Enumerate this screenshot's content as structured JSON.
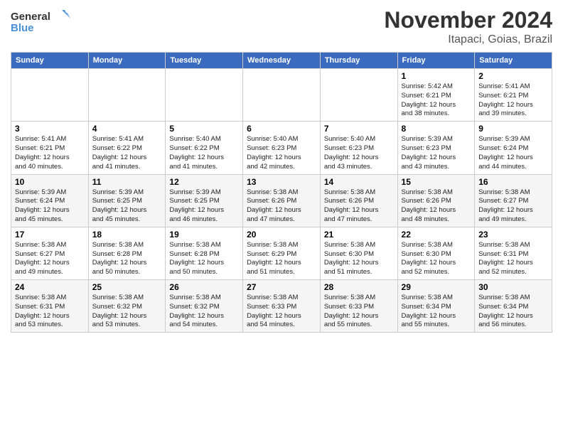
{
  "header": {
    "logo_line1": "General",
    "logo_line2": "Blue",
    "title": "November 2024",
    "subtitle": "Itapaci, Goias, Brazil"
  },
  "days_of_week": [
    "Sunday",
    "Monday",
    "Tuesday",
    "Wednesday",
    "Thursday",
    "Friday",
    "Saturday"
  ],
  "weeks": [
    [
      {
        "num": "",
        "info": ""
      },
      {
        "num": "",
        "info": ""
      },
      {
        "num": "",
        "info": ""
      },
      {
        "num": "",
        "info": ""
      },
      {
        "num": "",
        "info": ""
      },
      {
        "num": "1",
        "info": "Sunrise: 5:42 AM\nSunset: 6:21 PM\nDaylight: 12 hours\nand 38 minutes."
      },
      {
        "num": "2",
        "info": "Sunrise: 5:41 AM\nSunset: 6:21 PM\nDaylight: 12 hours\nand 39 minutes."
      }
    ],
    [
      {
        "num": "3",
        "info": "Sunrise: 5:41 AM\nSunset: 6:21 PM\nDaylight: 12 hours\nand 40 minutes."
      },
      {
        "num": "4",
        "info": "Sunrise: 5:41 AM\nSunset: 6:22 PM\nDaylight: 12 hours\nand 41 minutes."
      },
      {
        "num": "5",
        "info": "Sunrise: 5:40 AM\nSunset: 6:22 PM\nDaylight: 12 hours\nand 41 minutes."
      },
      {
        "num": "6",
        "info": "Sunrise: 5:40 AM\nSunset: 6:23 PM\nDaylight: 12 hours\nand 42 minutes."
      },
      {
        "num": "7",
        "info": "Sunrise: 5:40 AM\nSunset: 6:23 PM\nDaylight: 12 hours\nand 43 minutes."
      },
      {
        "num": "8",
        "info": "Sunrise: 5:39 AM\nSunset: 6:23 PM\nDaylight: 12 hours\nand 43 minutes."
      },
      {
        "num": "9",
        "info": "Sunrise: 5:39 AM\nSunset: 6:24 PM\nDaylight: 12 hours\nand 44 minutes."
      }
    ],
    [
      {
        "num": "10",
        "info": "Sunrise: 5:39 AM\nSunset: 6:24 PM\nDaylight: 12 hours\nand 45 minutes."
      },
      {
        "num": "11",
        "info": "Sunrise: 5:39 AM\nSunset: 6:25 PM\nDaylight: 12 hours\nand 45 minutes."
      },
      {
        "num": "12",
        "info": "Sunrise: 5:39 AM\nSunset: 6:25 PM\nDaylight: 12 hours\nand 46 minutes."
      },
      {
        "num": "13",
        "info": "Sunrise: 5:38 AM\nSunset: 6:26 PM\nDaylight: 12 hours\nand 47 minutes."
      },
      {
        "num": "14",
        "info": "Sunrise: 5:38 AM\nSunset: 6:26 PM\nDaylight: 12 hours\nand 47 minutes."
      },
      {
        "num": "15",
        "info": "Sunrise: 5:38 AM\nSunset: 6:26 PM\nDaylight: 12 hours\nand 48 minutes."
      },
      {
        "num": "16",
        "info": "Sunrise: 5:38 AM\nSunset: 6:27 PM\nDaylight: 12 hours\nand 49 minutes."
      }
    ],
    [
      {
        "num": "17",
        "info": "Sunrise: 5:38 AM\nSunset: 6:27 PM\nDaylight: 12 hours\nand 49 minutes."
      },
      {
        "num": "18",
        "info": "Sunrise: 5:38 AM\nSunset: 6:28 PM\nDaylight: 12 hours\nand 50 minutes."
      },
      {
        "num": "19",
        "info": "Sunrise: 5:38 AM\nSunset: 6:28 PM\nDaylight: 12 hours\nand 50 minutes."
      },
      {
        "num": "20",
        "info": "Sunrise: 5:38 AM\nSunset: 6:29 PM\nDaylight: 12 hours\nand 51 minutes."
      },
      {
        "num": "21",
        "info": "Sunrise: 5:38 AM\nSunset: 6:30 PM\nDaylight: 12 hours\nand 51 minutes."
      },
      {
        "num": "22",
        "info": "Sunrise: 5:38 AM\nSunset: 6:30 PM\nDaylight: 12 hours\nand 52 minutes."
      },
      {
        "num": "23",
        "info": "Sunrise: 5:38 AM\nSunset: 6:31 PM\nDaylight: 12 hours\nand 52 minutes."
      }
    ],
    [
      {
        "num": "24",
        "info": "Sunrise: 5:38 AM\nSunset: 6:31 PM\nDaylight: 12 hours\nand 53 minutes."
      },
      {
        "num": "25",
        "info": "Sunrise: 5:38 AM\nSunset: 6:32 PM\nDaylight: 12 hours\nand 53 minutes."
      },
      {
        "num": "26",
        "info": "Sunrise: 5:38 AM\nSunset: 6:32 PM\nDaylight: 12 hours\nand 54 minutes."
      },
      {
        "num": "27",
        "info": "Sunrise: 5:38 AM\nSunset: 6:33 PM\nDaylight: 12 hours\nand 54 minutes."
      },
      {
        "num": "28",
        "info": "Sunrise: 5:38 AM\nSunset: 6:33 PM\nDaylight: 12 hours\nand 55 minutes."
      },
      {
        "num": "29",
        "info": "Sunrise: 5:38 AM\nSunset: 6:34 PM\nDaylight: 12 hours\nand 55 minutes."
      },
      {
        "num": "30",
        "info": "Sunrise: 5:38 AM\nSunset: 6:34 PM\nDaylight: 12 hours\nand 56 minutes."
      }
    ]
  ]
}
